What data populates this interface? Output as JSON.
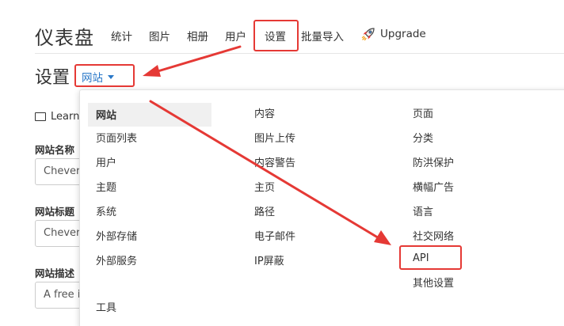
{
  "header": {
    "app_title": "仪表盘",
    "nav": {
      "stats": "统计",
      "images": "图片",
      "albums": "相册",
      "users": "用户",
      "settings": "设置",
      "bulk_import": "批量导入",
      "upgrade": "Upgrade"
    }
  },
  "section": {
    "title": "设置",
    "dropdown_label": "网站"
  },
  "form": {
    "learn_label": "Learn",
    "site_name_label": "网站名称",
    "site_name_value": "Chever",
    "site_title_label": "网站标题",
    "site_title_value": "Chever",
    "site_desc_label": "网站描述",
    "site_desc_value": "A free i"
  },
  "menu": {
    "col1": [
      "网站",
      "页面列表",
      "用户",
      "主题",
      "系统",
      "外部存储",
      "外部服务",
      "工具"
    ],
    "col2": [
      "内容",
      "图片上传",
      "内容警告",
      "主页",
      "路径",
      "电子邮件",
      "IP屏蔽"
    ],
    "col3": [
      "页面",
      "分类",
      "防洪保护",
      "横幅广告",
      "语言",
      "社交网络",
      "API",
      "其他设置"
    ]
  },
  "colors": {
    "accent": "#2a78c8",
    "highlight": "#e53935",
    "active_underline": "#3a7ec0"
  }
}
